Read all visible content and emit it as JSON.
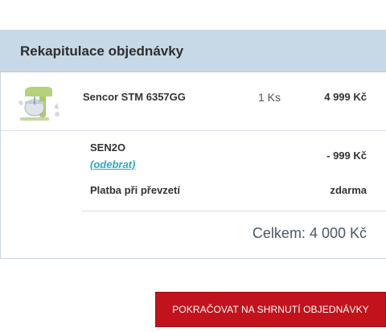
{
  "summary": {
    "title": "Rekapitulace objednávky",
    "product": {
      "name": "Sencor STM 6357GG",
      "quantity": "1 Ks",
      "price": "4 999 Kč",
      "image_icon": "stand-mixer-icon"
    },
    "coupon": {
      "code": "SEN2O",
      "remove_label": "(odebrat)",
      "discount": "- 999 Kč"
    },
    "payment": {
      "label": "Platba při převzetí",
      "value": "zdarma"
    },
    "total": "Celkem: 4 000 Kč"
  },
  "actions": {
    "continue_label": "POKRAČOVAT NA SHRNUTÍ OBJEDNÁVKY"
  },
  "colors": {
    "header_bg": "#c7d8e6",
    "accent_red": "#c2131d",
    "link": "#2aa8c4"
  }
}
